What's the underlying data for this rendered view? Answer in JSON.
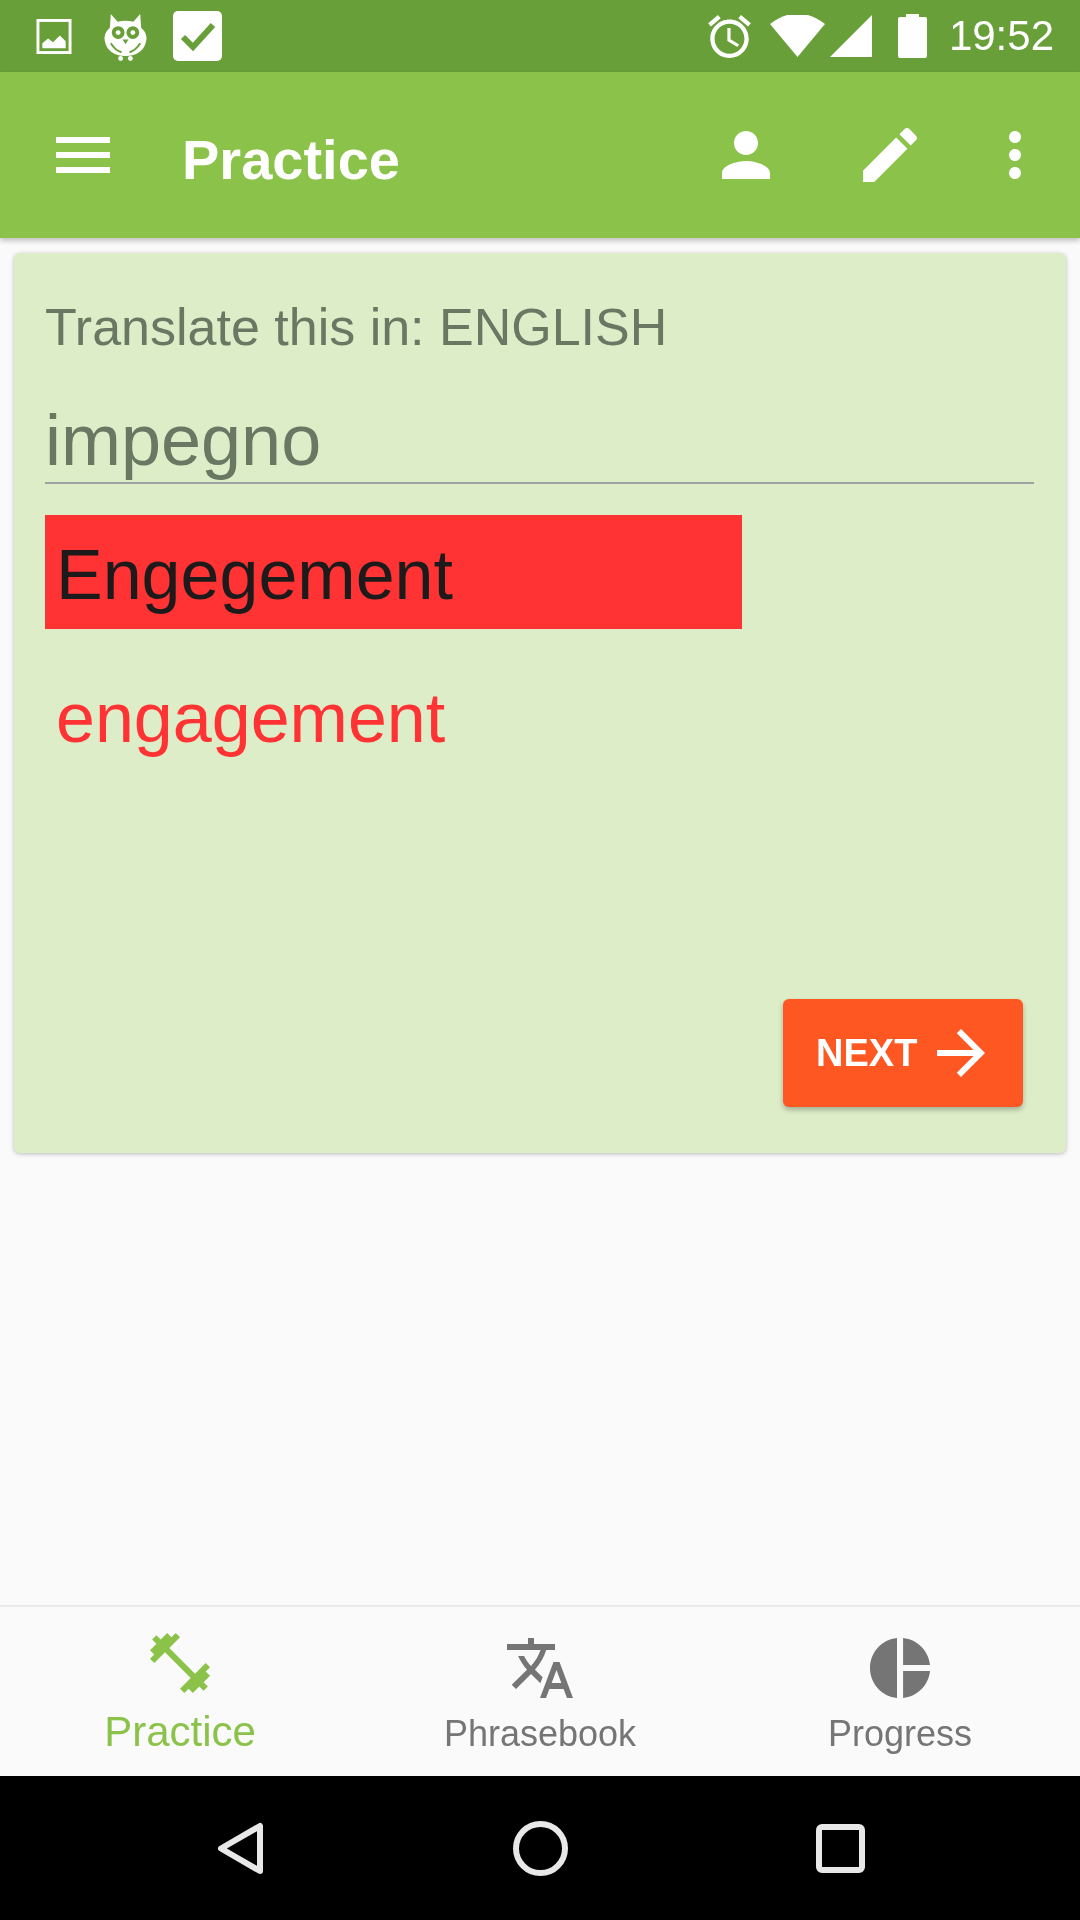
{
  "status_bar": {
    "time": "19:52"
  },
  "app_bar": {
    "title": "Practice"
  },
  "card": {
    "prompt": "Translate this in: ENGLISH",
    "input": {
      "value": "impegno"
    },
    "answer": {
      "text": "Engegement",
      "correct": false
    },
    "correction": "engagement",
    "next_button": {
      "label": "NEXT"
    }
  },
  "bottom_nav": [
    {
      "label": "Practice",
      "selected": true
    },
    {
      "label": "Phrasebook",
      "selected": false
    },
    {
      "label": "Progress",
      "selected": false
    }
  ]
}
